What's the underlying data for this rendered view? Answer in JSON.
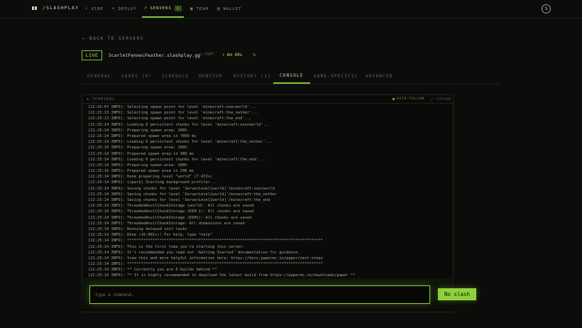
{
  "nav": {
    "brand": "/SLASHPLAY",
    "items": [
      {
        "icon": "lightning",
        "label": "VIBE"
      },
      {
        "icon": "plus",
        "label": "DEPLOY"
      },
      {
        "icon": "rocket",
        "label": "SERVERS",
        "badge": "1"
      },
      {
        "icon": "team",
        "label": "TEAM"
      },
      {
        "icon": "wallet",
        "label": "WALLET"
      }
    ],
    "avatar": "S"
  },
  "back": {
    "arrow": "←",
    "label": "BACK TO SERVERS"
  },
  "server": {
    "status": "LIVE",
    "hostname": "ScarletFennecFeather.slashplay.gg",
    "copy_label": "COPY",
    "uptime": "6m 40s",
    "refresh_icon": "refresh"
  },
  "tabs": [
    "GENERAL",
    "SAVES (0)",
    "SCHEDULE",
    "MONITOR",
    "HISTORY (1)",
    "CONSOLE",
    "GAME-SPECIFIC",
    "ADVANCED"
  ],
  "active_tab": "CONSOLE",
  "terminal": {
    "title": "TERMINAL",
    "autofollow": "AUTO-FOLLOW",
    "expand": "EXPAND",
    "lines": [
      "[22:25:07 INFO]: Selecting spawn point for level 'minecraft:overworld'...",
      "[22:25:13 INFO]: Selecting spawn point for level 'minecraft:the_nether'...",
      "[22:25:13 INFO]: Selecting spawn point for level 'minecraft:the_end'...",
      "[22:25:14 INFO]: Loading 0 persistent chunks for level 'minecraft:overworld'...",
      "[22:25:14 INFO]: Preparing spawn area: 100%",
      "[22:25:14 INFO]: Prepared spawn area in 7099 ms",
      "[22:25:14 INFO]: Loading 0 persistent chunks for level 'minecraft:the_nether'...",
      "[22:25:14 INFO]: Preparing spawn area: 100%",
      "[22:25:14 INFO]: Prepared spawn area in 989 ms",
      "[22:25:14 INFO]: Loading 0 persistent chunks for level 'minecraft:the_end'...",
      "[22:25:14 INFO]: Preparing spawn area: 100%",
      "[22:25:16 INFO]: Prepared spawn area in 296 ms",
      "[22:25:14 INFO]: Done preparing level \"world\" (7.472s)",
      "[22:25:14 INFO]: [spark] Starting background profiler...",
      "[22:25:14 INFO]: Saving chunks for level 'ServerLevel[world]'/minecraft:overworld",
      "[22:25:14 INFO]: Saving chunks for level 'ServerLevel[world]'/minecraft:the_nether",
      "[22:25:14 INFO]: Saving chunks for level 'ServerLevel[world]'/minecraft:the_end",
      "[22:25:14 INFO]: ThreadedAnvilChunkStorage (world): All chunks are saved",
      "[22:25:14 INFO]: ThreadedAnvilChunkStorage (DIM-1): All chunks are saved",
      "[22:25:14 INFO]: ThreadedAnvilChunkStorage (DIM1): All chunks are saved",
      "[22:25:14 INFO]: ThreadedAnvilChunkStorage: All dimensions are saved",
      "[22:25:14 INFO]: Running delayed init tasks",
      "[22:25:14 INFO]: Done (16.001s)! For help, type \"help\"",
      "[22:25:14 INFO]: *************************************************************************************",
      "[22:25:14 INFO]: This is the first time you're starting this server.",
      "[22:25:14 INFO]: It's recommended you read our 'Getting Started' documentation for guidance.",
      "[22:25:14 INFO]: View this and more helpful information here: https://docs.papermc.io/paper/next-steps",
      "[22:25:14 INFO]: *************************************************************************************",
      "[22:25:14 INFO]: ** Currently you are 6 builds behind **",
      "[22:25:14 INFO]: ** It is highly recommended to download the latest build from https://papermc.io/downloads/paper **"
    ]
  },
  "command": {
    "placeholder": "type a command…",
    "mode_button": "No slash"
  }
}
